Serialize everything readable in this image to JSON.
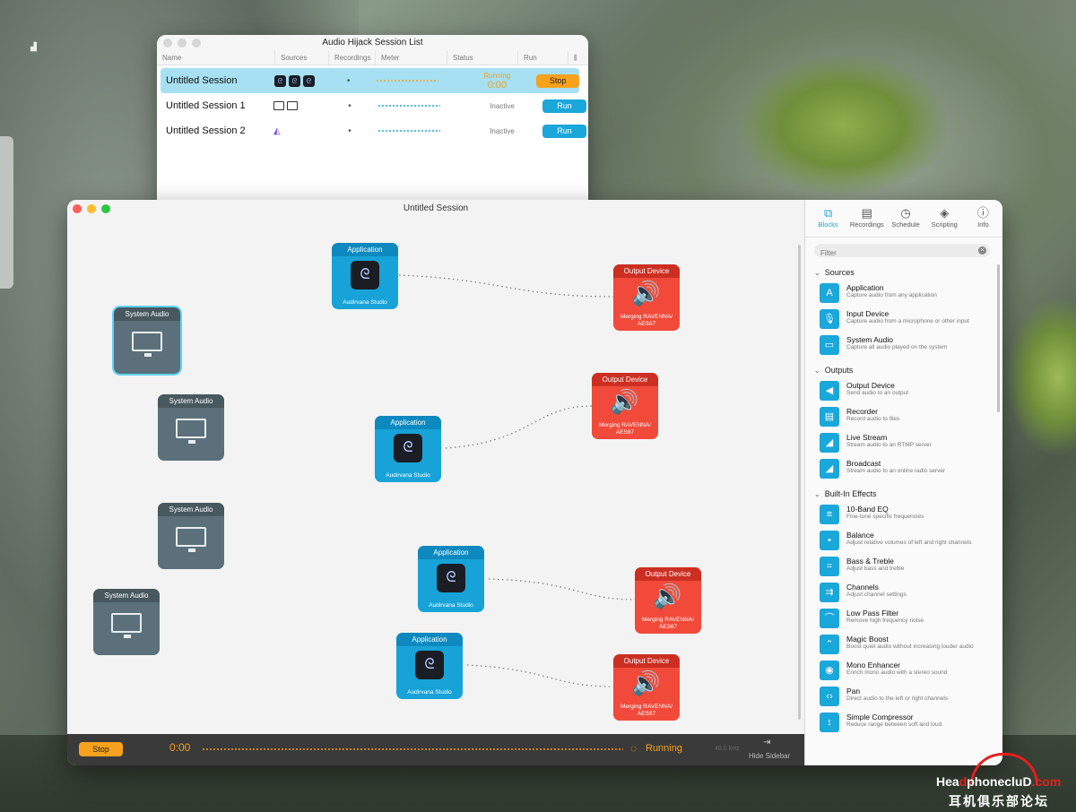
{
  "list_window": {
    "title": "Audio Hijack Session List",
    "columns": [
      "Name",
      "Sources",
      "Recordings",
      "Meter",
      "Status",
      "Run"
    ],
    "rows": [
      {
        "name": "Untitled Session",
        "status": "Running",
        "time": "0:00",
        "button": "Stop",
        "rec": "•"
      },
      {
        "name": "Untitled Session 1",
        "status": "Inactive",
        "button": "Run",
        "rec": "•"
      },
      {
        "name": "Untitled Session 2",
        "status": "Inactive",
        "button": "Run",
        "rec": "•"
      }
    ]
  },
  "main_window": {
    "title": "Untitled Session",
    "blocks": {
      "app_label": "Application",
      "app_sub": "Audirvana Studio",
      "out_label": "Output Device",
      "out_sub": "Merging RAVENNA/ AES67",
      "sys_label": "System Audio"
    },
    "transport": {
      "stop": "Stop",
      "time": "0:00",
      "status": "Running",
      "rate": "48.0 kHz",
      "hide_sidebar": "Hide Sidebar"
    }
  },
  "sidebar": {
    "tabs": [
      {
        "label": "Blocks",
        "icon": "blocks-icon"
      },
      {
        "label": "Recordings",
        "icon": "recordings-icon"
      },
      {
        "label": "Schedule",
        "icon": "clock-icon"
      },
      {
        "label": "Scripting",
        "icon": "scripting-icon"
      },
      {
        "label": "Info",
        "icon": "info-icon"
      }
    ],
    "filter_placeholder": "Filter",
    "sections": [
      {
        "title": "Sources",
        "items": [
          {
            "title": "Application",
            "desc": "Capture audio from any application",
            "glyph": "A"
          },
          {
            "title": "Input Device",
            "desc": "Capture audio from a microphone or other input",
            "glyph": "🎙"
          },
          {
            "title": "System Audio",
            "desc": "Capture all audio played on the system",
            "glyph": "▭"
          }
        ]
      },
      {
        "title": "Outputs",
        "items": [
          {
            "title": "Output Device",
            "desc": "Send audio to an output",
            "glyph": "◀"
          },
          {
            "title": "Recorder",
            "desc": "Record audio to files",
            "glyph": "▤"
          },
          {
            "title": "Live Stream",
            "desc": "Stream audio to an RTMP server",
            "glyph": "◢"
          },
          {
            "title": "Broadcast",
            "desc": "Stream audio to an online radio server",
            "glyph": "◢"
          }
        ]
      },
      {
        "title": "Built-In Effects",
        "items": [
          {
            "title": "10-Band EQ",
            "desc": "Fine-tune specific frequencies",
            "glyph": "≡"
          },
          {
            "title": "Balance",
            "desc": "Adjust relative volumes of left and right channels",
            "glyph": "•"
          },
          {
            "title": "Bass & Treble",
            "desc": "Adjust bass and treble",
            "glyph": "="
          },
          {
            "title": "Channels",
            "desc": "Adjust channel settings",
            "glyph": "⇉"
          },
          {
            "title": "Low Pass Filter",
            "desc": "Remove high frequency noise",
            "glyph": "⌒"
          },
          {
            "title": "Magic Boost",
            "desc": "Boost quiet audio without increasing louder audio",
            "glyph": "⌃"
          },
          {
            "title": "Mono Enhancer",
            "desc": "Enrich mono audio with a stereo sound",
            "glyph": "◉"
          },
          {
            "title": "Pan",
            "desc": "Direct audio to the left or right channels",
            "glyph": "‹›"
          },
          {
            "title": "Simple Compressor",
            "desc": "Reduce range between soft and loud",
            "glyph": "↕"
          }
        ]
      }
    ]
  },
  "watermark": {
    "line1a": "Hea",
    "line1b": "phonecluD",
    "line1c": ".com",
    "line2": "耳机俱乐部论坛"
  }
}
